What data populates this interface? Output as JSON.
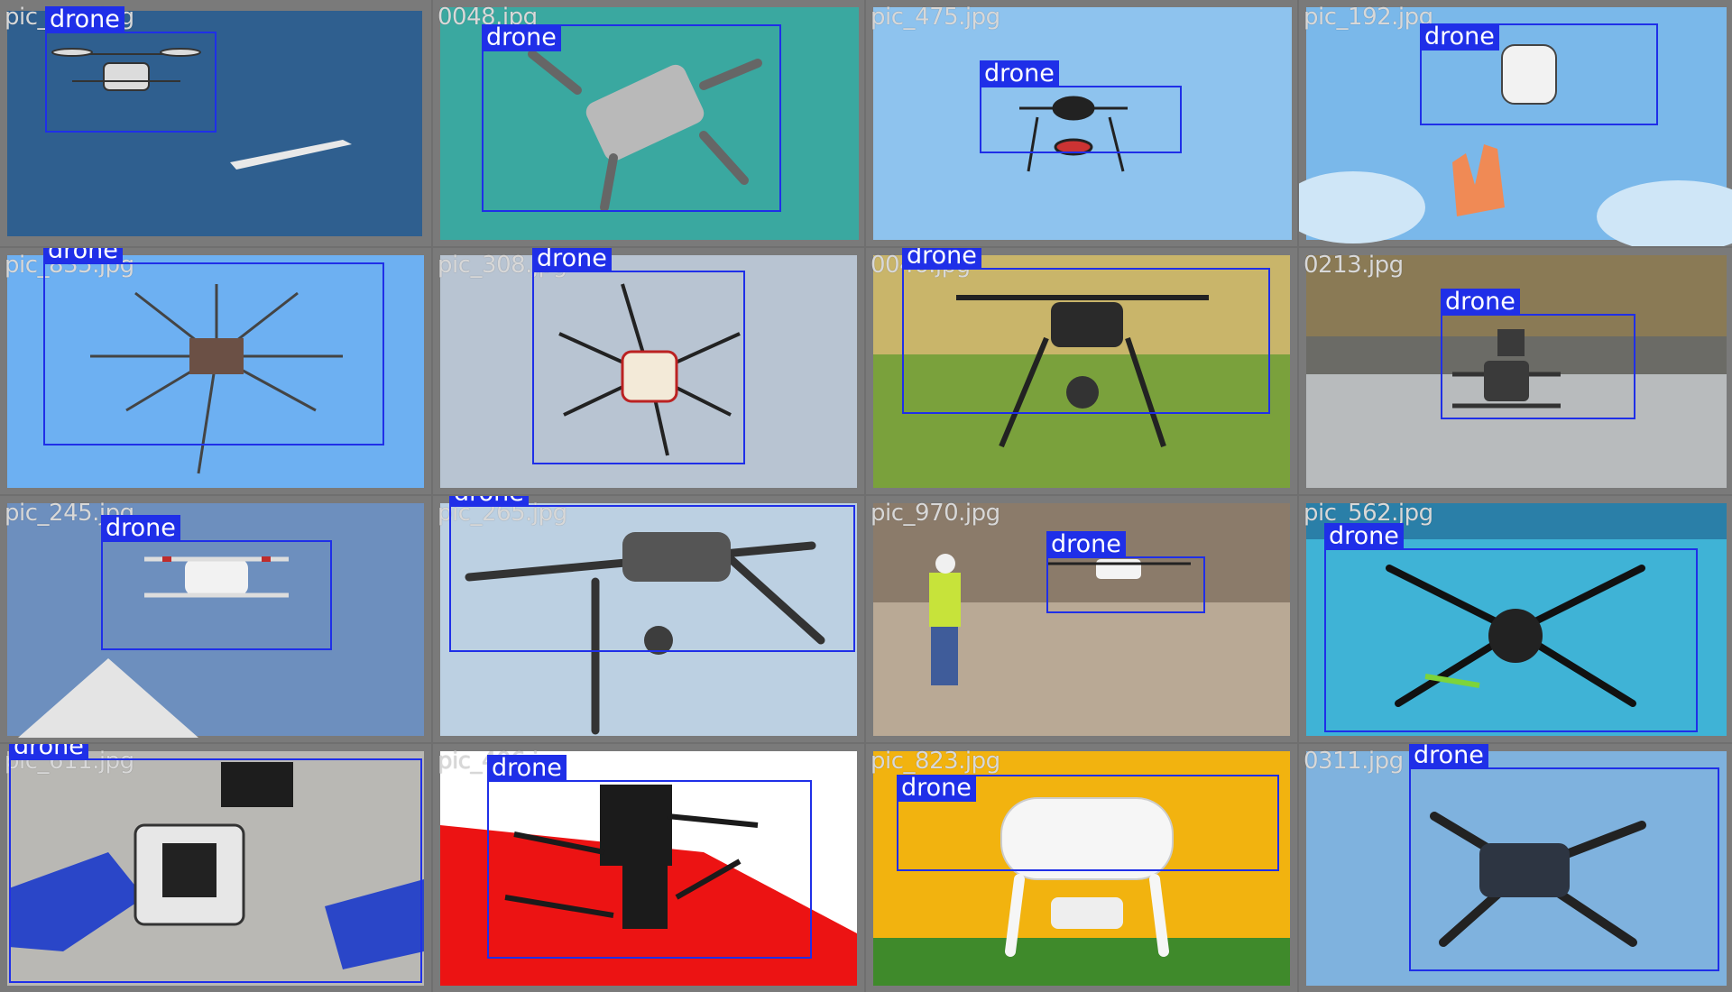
{
  "tiles": [
    {
      "file": "pic_105.jpg",
      "label": "drone"
    },
    {
      "file": "0048.jpg",
      "label": "drone"
    },
    {
      "file": "pic_475.jpg",
      "label": "drone"
    },
    {
      "file": "pic_192.jpg",
      "label": "drone"
    },
    {
      "file": "pic_835.jpg",
      "label": "drone"
    },
    {
      "file": "pic_308.jpg",
      "label": "drone"
    },
    {
      "file": "0046.jpg",
      "label": "drone"
    },
    {
      "file": "0213.jpg",
      "label": "drone"
    },
    {
      "file": "pic_245.jpg",
      "label": "drone"
    },
    {
      "file": "pic_265.jpg",
      "label": "drone"
    },
    {
      "file": "pic_970.jpg",
      "label": "drone"
    },
    {
      "file": "pic_562.jpg",
      "label": "drone"
    },
    {
      "file": "pic_611.jpg",
      "label": "drone"
    },
    {
      "file": "pic_406.jpg",
      "label": "drone"
    },
    {
      "file": "pic_823.jpg",
      "label": "drone"
    },
    {
      "file": "0311.jpg",
      "label": "drone"
    }
  ],
  "colors": {
    "box": "#1f2fe8",
    "label_text": "#ffffff",
    "filename_text": "#d8d8d8",
    "border": "#7a7a7a"
  }
}
